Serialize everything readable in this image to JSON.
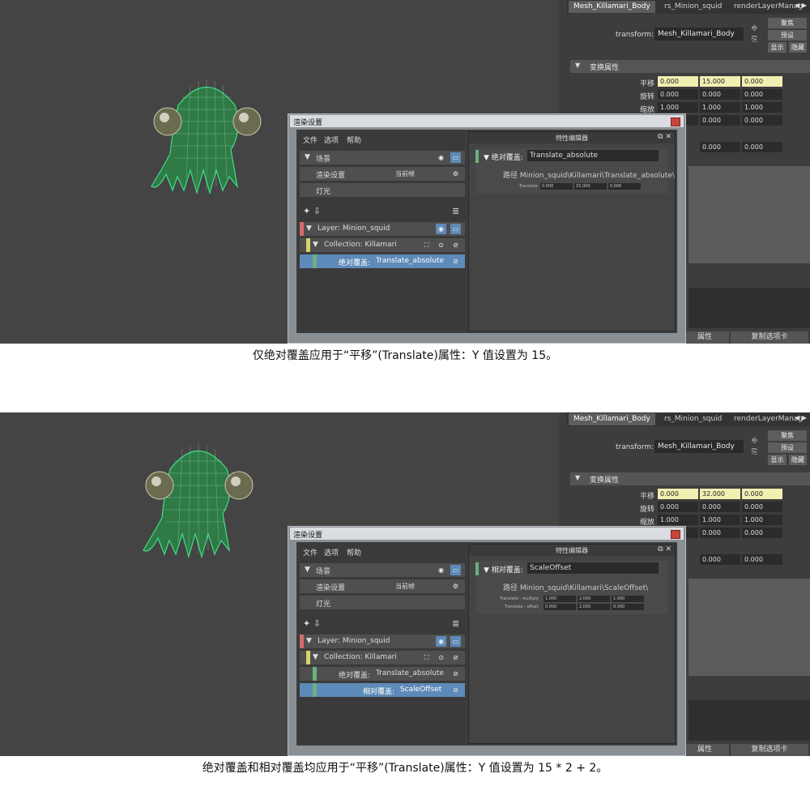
{
  "panels": [
    {
      "attribute_editor": {
        "tabs": [
          "Mesh_Killamari_Body",
          "rs_Minion_squid",
          "renderLayerManag"
        ],
        "transform_label": "transform:",
        "transform_value": "Mesh_Killamari_Body",
        "buttons": [
          "聚焦",
          "预设",
          "显示",
          "隐藏"
        ],
        "section_title": "变换属性",
        "rows": [
          {
            "label": "平移",
            "values": [
              "0.000",
              "15.000",
              "0.000"
            ],
            "keyed": true
          },
          {
            "label": "旋转",
            "values": [
              "0.000",
              "0.000",
              "0.000"
            ],
            "keyed": false
          },
          {
            "label": "缩放",
            "values": [
              "1.000",
              "1.000",
              "1.000"
            ],
            "keyed": false
          },
          {
            "label": "",
            "values": [
              "0.000",
              "0.000",
              "0.000"
            ],
            "keyed": false
          }
        ],
        "extra_values": [
          "0.000",
          "0.000"
        ],
        "partial_label": "换",
        "bottom_buttons": [
          "属性",
          "复制选项卡"
        ]
      },
      "render_setup": {
        "title": "渲染设置",
        "menu": [
          "文件",
          "选项",
          "帮助"
        ],
        "scene_rows": [
          {
            "label": "场景",
            "extra": ""
          },
          {
            "label": "渲染设置",
            "extra": "当前帧"
          },
          {
            "label": "灯光",
            "extra": ""
          }
        ],
        "layer": "Layer:   Minion_squid",
        "collection": "Collection:   Killamari",
        "overrides": [
          {
            "type": "绝对覆盖:",
            "name": "Translate_absolute",
            "selected": true
          }
        ],
        "property_editor": {
          "header": "特性编辑器",
          "override_type": "绝对覆盖:",
          "override_name": "Translate_absolute",
          "path_label": "路径",
          "path": "Minion_squid\\Killamari\\Translate_absolute\\",
          "attrs": [
            {
              "label": "Translate",
              "values": [
                "0.000",
                "15.000",
                "0.000"
              ]
            }
          ]
        }
      },
      "caption": "仅绝对覆盖应用于“平移”(Translate)属性：Y 值设置为 15。"
    },
    {
      "attribute_editor": {
        "tabs": [
          "Mesh_Killamari_Body",
          "rs_Minion_squid",
          "renderLayerManag"
        ],
        "transform_label": "transform:",
        "transform_value": "Mesh_Killamari_Body",
        "buttons": [
          "聚焦",
          "预设",
          "显示",
          "隐藏"
        ],
        "section_title": "变换属性",
        "rows": [
          {
            "label": "平移",
            "values": [
              "0.000",
              "32.000",
              "0.000"
            ],
            "keyed": true
          },
          {
            "label": "旋转",
            "values": [
              "0.000",
              "0.000",
              "0.000"
            ],
            "keyed": false
          },
          {
            "label": "缩放",
            "values": [
              "1.000",
              "1.000",
              "1.000"
            ],
            "keyed": false
          },
          {
            "label": "",
            "values": [
              "0.000",
              "0.000",
              "0.000"
            ],
            "keyed": false
          }
        ],
        "extra_values": [
          "0.000",
          "0.000"
        ],
        "partial_label": "换",
        "bottom_buttons": [
          "属性",
          "复制选项卡"
        ]
      },
      "render_setup": {
        "title": "渲染设置",
        "menu": [
          "文件",
          "选项",
          "帮助"
        ],
        "scene_rows": [
          {
            "label": "场景",
            "extra": ""
          },
          {
            "label": "渲染设置",
            "extra": "当前帧"
          },
          {
            "label": "灯光",
            "extra": ""
          }
        ],
        "layer": "Layer:   Minion_squid",
        "collection": "Collection:   Killamari",
        "overrides": [
          {
            "type": "绝对覆盖:",
            "name": "Translate_absolute",
            "selected": false
          },
          {
            "type": "相对覆盖:",
            "name": "ScaleOffset",
            "selected": true
          }
        ],
        "property_editor": {
          "header": "特性编辑器",
          "override_type": "相对覆盖:",
          "override_name": "ScaleOffset",
          "path_label": "路径",
          "path": "Minion_squid\\Killamari\\ScaleOffset\\",
          "attrs": [
            {
              "label": "Translate : multiply",
              "values": [
                "1.000",
                "2.000",
                "1.000"
              ]
            },
            {
              "label": "Translate : offset",
              "values": [
                "0.000",
                "2.000",
                "0.000"
              ]
            }
          ]
        }
      },
      "caption": "绝对覆盖和相对覆盖均应用于“平移”(Translate)属性：Y 值设置为 15 * 2 + 2。"
    }
  ],
  "colors": {
    "viewport": "#444444",
    "wire": "#3fe08a",
    "keyed_field": "#f1efb2",
    "selection": "#5d8ab8",
    "layer_strip": "#d36b6b",
    "collection_strip": "#d9d36a",
    "override_strip": "#6ab27c"
  }
}
